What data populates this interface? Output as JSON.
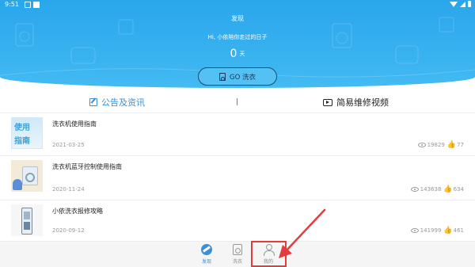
{
  "status_bar": {
    "time": "9:51"
  },
  "header": {
    "title": "发现",
    "greeting": "Hi, 小依陪你走过的日子",
    "days_value": "0",
    "days_unit": "天",
    "go_button": "GO 洗衣"
  },
  "tabs": [
    {
      "label": "公告及资讯",
      "active": true
    },
    {
      "label": "简易维修视频",
      "active": false
    }
  ],
  "articles": [
    {
      "title": "洗衣机使用指南",
      "date": "2021-03-25",
      "views": "19829",
      "likes": "77",
      "thumb_text": [
        "使用",
        "指南"
      ]
    },
    {
      "title": "洗衣机蓝牙控制使用指南",
      "date": "2020-11-24",
      "views": "143638",
      "likes": "634"
    },
    {
      "title": "小依洗衣报修攻略",
      "date": "2020-09-12",
      "views": "141999",
      "likes": "461"
    }
  ],
  "bottom_nav": [
    {
      "label": "发现",
      "active": true,
      "icon": "compass-icon"
    },
    {
      "label": "洗衣",
      "active": false,
      "icon": "washer-icon"
    },
    {
      "label": "我的",
      "active": false,
      "icon": "user-icon"
    }
  ],
  "colors": {
    "accent": "#3a8fd6",
    "header": "#3ab3f0",
    "annotation": "#e23c3c"
  }
}
